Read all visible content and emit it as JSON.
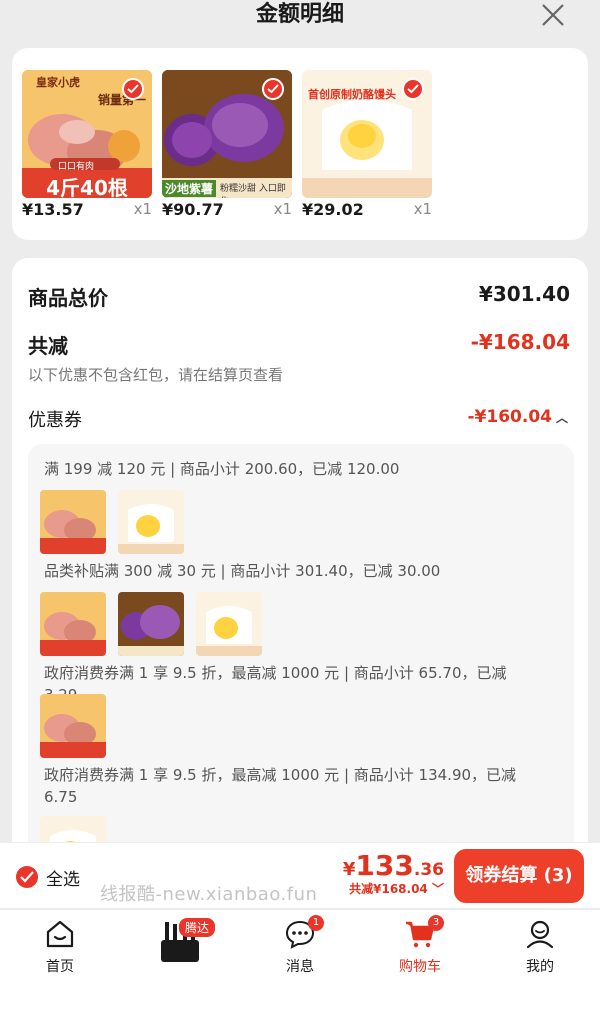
{
  "header": {
    "title": "金额明细"
  },
  "products": [
    {
      "price": "¥13.57",
      "qty": "x1",
      "img_text_top": "皇家小虎",
      "img_text_mid": "销量第一",
      "img_text_badge": "口口有肉",
      "img_text_bottom": "4斤40根"
    },
    {
      "price": "¥90.77",
      "qty": "x1",
      "img_text_bottom": "沙地紫薯",
      "img_text_sub": "粉糯沙甜 入口即化"
    },
    {
      "price": "¥29.02",
      "qty": "x1",
      "img_text_top": "首创原制奶酪馒头"
    }
  ],
  "summary": {
    "total_label": "商品总价",
    "total_value": "¥301.40",
    "reduce_label": "共减",
    "reduce_value": "-¥168.04",
    "note": "以下优惠不包含红包，请在结算页查看",
    "coupon_label": "优惠券",
    "coupon_value": "-¥160.04"
  },
  "coupons": [
    {
      "text": "满 199 减 120 元 | 商品小计 200.60，已减 120.00"
    },
    {
      "text": "品类补贴满 300 减 30 元 | 商品小计 301.40，已减 30.00"
    },
    {
      "text": "政府消费券满 1 享 9.5 折，最高减 1000 元 | 商品小计 65.70，已减 3.29"
    },
    {
      "text": "政府消费券满 1 享 9.5 折，最高减 1000 元 | 商品小计 134.90，已减 6.75"
    }
  ],
  "bottom": {
    "select_all": "全选",
    "price_symbol": "¥",
    "price_int": "133",
    "price_dec": ".36",
    "saved": "共减¥168.04",
    "checkout": "领券结算 (3)",
    "watermark": "线报酷-new.xianbao.fun"
  },
  "tabbar": {
    "home": "首页",
    "router_badge": "腾达",
    "messages": "消息",
    "messages_badge": "1",
    "cart": "购物车",
    "cart_badge": "3",
    "me": "我的"
  },
  "colors": {
    "accent": "#e2311d",
    "button": "#ee3f2a"
  }
}
